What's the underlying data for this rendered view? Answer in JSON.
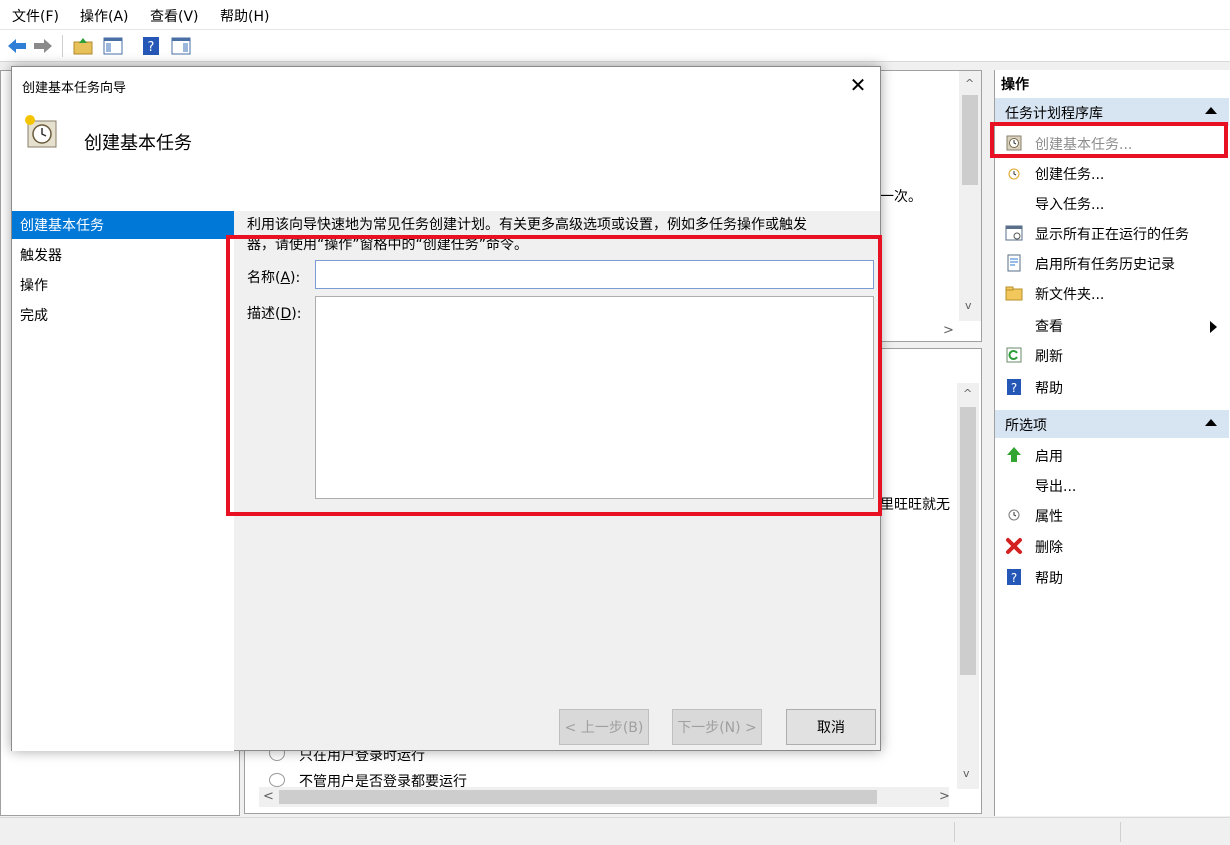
{
  "menu": [
    "文件(F)",
    "操作(A)",
    "查看(V)",
    "帮助(H)"
  ],
  "background": {
    "text_once": "一次。",
    "text_wangwang": "里旺旺就无",
    "radio1": "只在用户登录时运行",
    "radio2": "不管用户是否登录都要运行"
  },
  "actions": {
    "title": "操作",
    "section1": "任务计划程序库",
    "items1": [
      {
        "label": "创建基本任务...",
        "icon": "create-basic-task-icon"
      },
      {
        "label": "创建任务...",
        "icon": "create-task-icon"
      },
      {
        "label": "导入任务...",
        "icon": ""
      },
      {
        "label": "显示所有正在运行的任务",
        "icon": "running-tasks-icon"
      },
      {
        "label": "启用所有任务历史记录",
        "icon": "history-icon"
      },
      {
        "label": "新文件夹...",
        "icon": "folder-icon"
      },
      {
        "label": "查看",
        "icon": ""
      },
      {
        "label": "刷新",
        "icon": "refresh-icon"
      },
      {
        "label": "帮助",
        "icon": "help-icon"
      }
    ],
    "section2": "所选项",
    "items2": [
      {
        "label": "启用",
        "icon": "enable-arrow-icon"
      },
      {
        "label": "导出...",
        "icon": ""
      },
      {
        "label": "属性",
        "icon": "properties-icon"
      },
      {
        "label": "删除",
        "icon": "delete-icon"
      },
      {
        "label": "帮助",
        "icon": "help-icon"
      }
    ]
  },
  "dialog": {
    "title": "创建基本任务向导",
    "heading": "创建基本任务",
    "nav": [
      "创建基本任务",
      "触发器",
      "操作",
      "完成"
    ],
    "description_line1": "利用该向导快速地为常见任务创建计划。有关更多高级选项或设置，例如多任务操作或触发",
    "description_line2": "器，请使用“操作”窗格中的“创建任务”命令。",
    "name_label": "名称(",
    "name_key": "A",
    "name_suffix": "):",
    "desc_label": "描述(",
    "desc_key": "D",
    "desc_suffix": "):",
    "name_value": "",
    "desc_value": "",
    "btn_back": "< 上一步(B)",
    "btn_next": "下一步(N) >",
    "btn_cancel": "取消"
  },
  "colors": {
    "highlight": "#e81123",
    "selection": "#0078d7",
    "section_header": "#d7e4f2"
  }
}
